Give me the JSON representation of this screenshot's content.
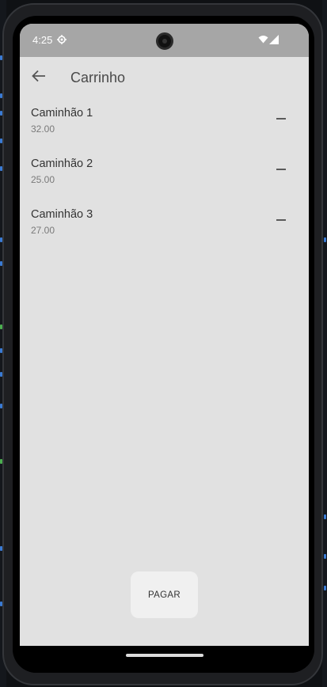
{
  "status_bar": {
    "time": "4:25"
  },
  "app_bar": {
    "title": "Carrinho"
  },
  "cart": {
    "items": [
      {
        "name": "Caminhão 1",
        "price": "32.00"
      },
      {
        "name": "Caminhão 2",
        "price": "25.00"
      },
      {
        "name": "Caminhão 3",
        "price": "27.00"
      }
    ]
  },
  "pay_button": {
    "label": "PAGAR"
  },
  "icons": {
    "back": "arrow-back-icon",
    "remove": "remove-icon",
    "wifi": "wifi-icon",
    "signal": "signal-icon",
    "gps": "gps-icon"
  },
  "colors": {
    "screen_background": "#e1e1e1",
    "status_bar": "#a6a6a6",
    "button_background": "#f0f0f0"
  }
}
